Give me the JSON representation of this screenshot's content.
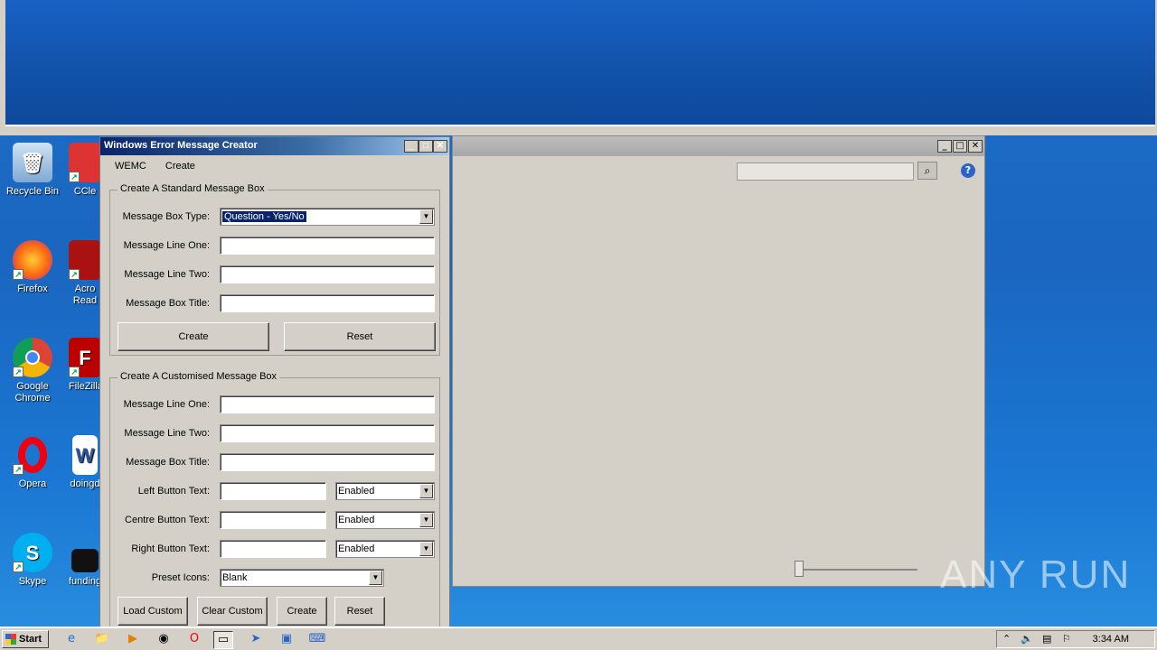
{
  "desktop": {
    "icons": [
      {
        "label": "Recycle Bin"
      },
      {
        "label": "CCle"
      },
      {
        "label": "Firefox"
      },
      {
        "label": "Acro",
        "label2": "Read"
      },
      {
        "label": "Google",
        "label2": "Chrome"
      },
      {
        "label": "FileZilla"
      },
      {
        "label": "Opera"
      },
      {
        "label": "doingd"
      },
      {
        "label": "Skype"
      },
      {
        "label": "funding"
      }
    ]
  },
  "app": {
    "title": "Windows Error Message Creator",
    "menu": [
      "WEMC",
      "Create"
    ],
    "standard": {
      "legend": "Create A Standard Message Box",
      "type_label": "Message Box Type:",
      "type_value": "Question - Yes/No",
      "line1_label": "Message Line One:",
      "line2_label": "Message Line Two:",
      "title_label": "Message Box Title:",
      "create": "Create",
      "reset": "Reset"
    },
    "custom": {
      "legend": "Create A Customised Message Box",
      "line1_label": "Message Line One:",
      "line2_label": "Message Line Two:",
      "title_label": "Message Box Title:",
      "left_label": "Left Button Text:",
      "left_state": "Enabled",
      "centre_label": "Centre Button Text:",
      "centre_state": "Enabled",
      "right_label": "Right Button Text:",
      "right_state": "Enabled",
      "icons_label": "Preset Icons:",
      "icons_value": "Blank",
      "load": "Load Custom",
      "clear": "Clear Custom",
      "create": "Create",
      "reset": "Reset"
    }
  },
  "taskbar": {
    "start": "Start",
    "clock": "3:34 AM"
  },
  "watermark": "ANY RUN"
}
